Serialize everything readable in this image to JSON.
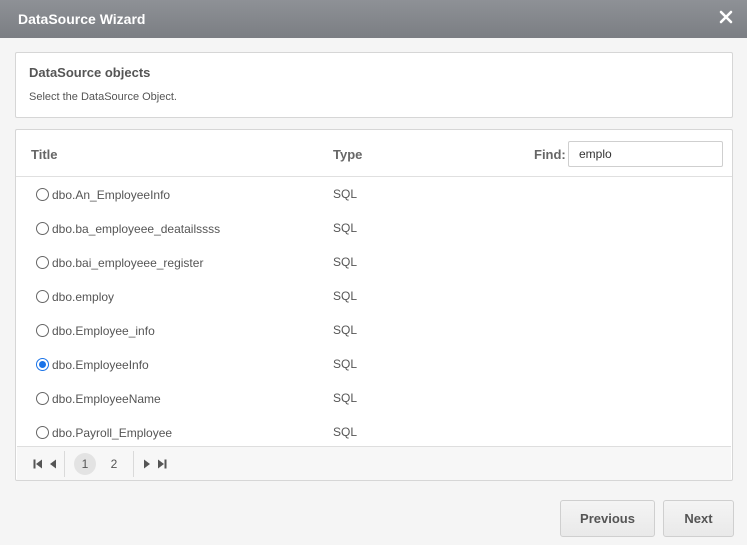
{
  "window": {
    "title": "DataSource Wizard"
  },
  "info": {
    "heading": "DataSource objects",
    "subtext": "Select the DataSource Object."
  },
  "grid": {
    "columns": {
      "title": "Title",
      "type": "Type"
    },
    "find": {
      "label": "Find:",
      "value": "emplo"
    },
    "rows": [
      {
        "title": "dbo.An_EmployeeInfo",
        "type": "SQL",
        "selected": false
      },
      {
        "title": "dbo.ba_employeee_deatailssss",
        "type": "SQL",
        "selected": false
      },
      {
        "title": "dbo.bai_employeee_register",
        "type": "SQL",
        "selected": false
      },
      {
        "title": "dbo.employ",
        "type": "SQL",
        "selected": false
      },
      {
        "title": "dbo.Employee_info",
        "type": "SQL",
        "selected": false
      },
      {
        "title": "dbo.EmployeeInfo",
        "type": "SQL",
        "selected": true
      },
      {
        "title": "dbo.EmployeeName",
        "type": "SQL",
        "selected": false
      },
      {
        "title": "dbo.Payroll_Employee",
        "type": "SQL",
        "selected": false
      }
    ],
    "pager": {
      "pages": [
        "1",
        "2"
      ],
      "current_page": "1"
    }
  },
  "buttons": {
    "previous": "Previous",
    "next": "Next"
  },
  "colors": {
    "titlebar": "#7b7e83",
    "selected_radio": "#1a73e8"
  }
}
